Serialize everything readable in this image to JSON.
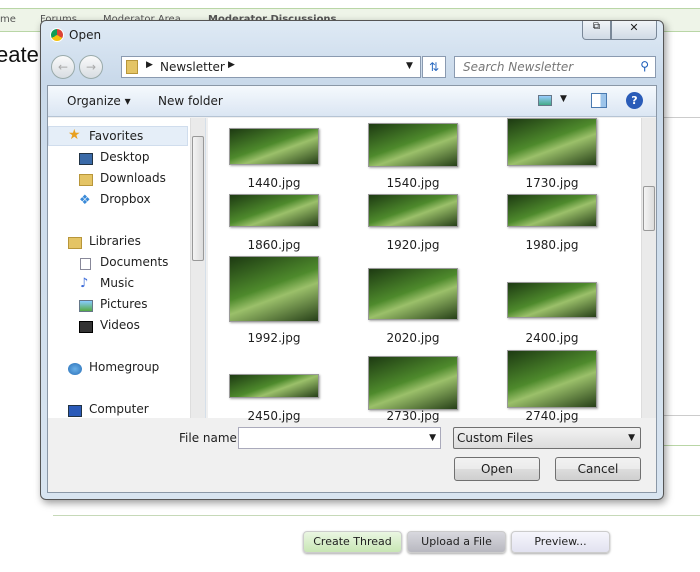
{
  "page": {
    "breadcrumbs": [
      "me",
      "Forums",
      "Moderator Area",
      "Moderator Discussions"
    ],
    "heading": "eate",
    "buttons": {
      "create_thread": "Create Thread",
      "upload_file": "Upload a File",
      "preview": "Preview..."
    }
  },
  "dialog": {
    "title": "Open",
    "address": {
      "path": "Newsletter",
      "search_placeholder": "Search Newsletter"
    },
    "toolbar": {
      "organize": "Organize",
      "new_folder": "New folder"
    },
    "nav": {
      "favorites": {
        "label": "Favorites",
        "items": [
          "Desktop",
          "Downloads",
          "Dropbox"
        ]
      },
      "libraries": {
        "label": "Libraries",
        "items": [
          "Documents",
          "Music",
          "Pictures",
          "Videos"
        ]
      },
      "homegroup": "Homegroup",
      "computer": "Computer"
    },
    "files": [
      "1440.jpg",
      "1540.jpg",
      "1730.jpg",
      "1860.jpg",
      "1920.jpg",
      "1980.jpg",
      "1992.jpg",
      "2020.jpg",
      "2400.jpg",
      "2450.jpg",
      "2730.jpg",
      "2740.jpg"
    ],
    "footer": {
      "file_name_label": "File name:",
      "file_name_value": "",
      "file_type": "Custom Files",
      "open": "Open",
      "cancel": "Cancel"
    }
  }
}
